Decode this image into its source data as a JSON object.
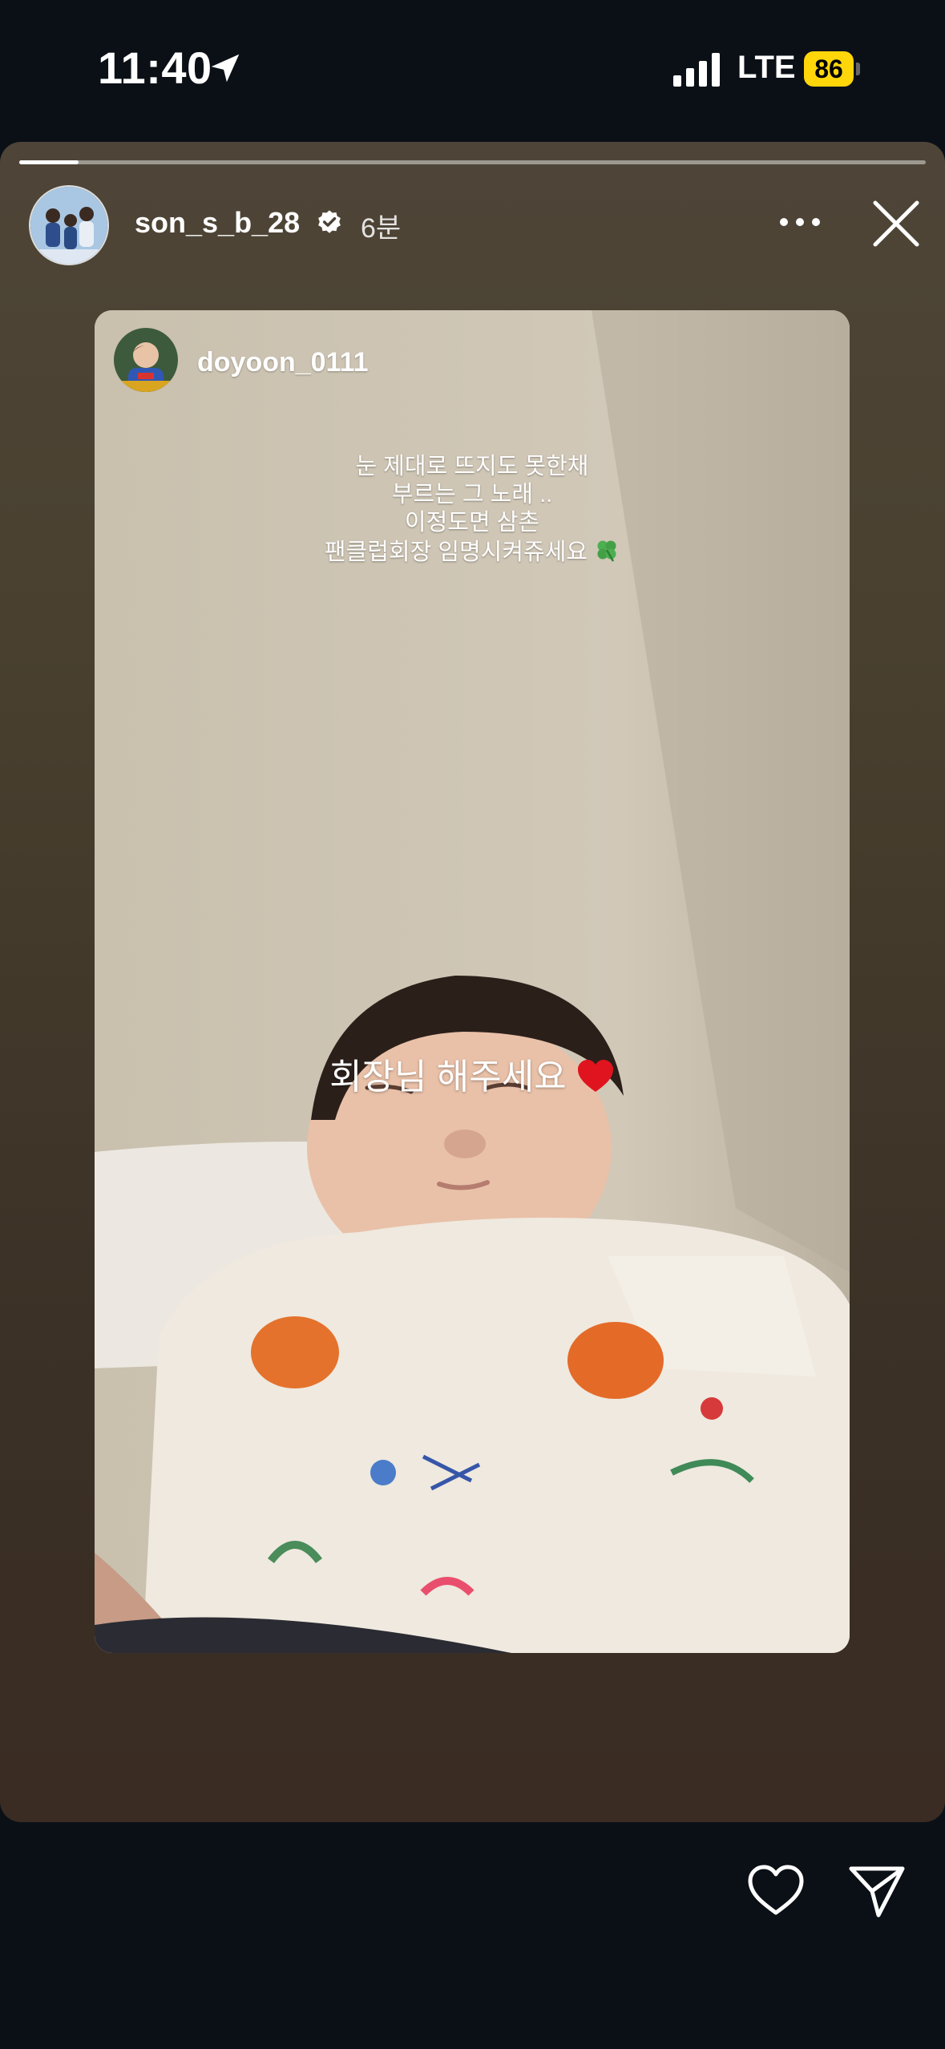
{
  "status_bar": {
    "time": "11:40",
    "network": "LTE",
    "battery": "86",
    "battery_color": "#ffd60a",
    "icons": [
      "location-arrow-icon",
      "signal-bars-icon",
      "battery-icon"
    ]
  },
  "story": {
    "progress_fraction": 0.065,
    "author": {
      "username": "son_s_b_28",
      "verified": true,
      "time_ago": "6분"
    },
    "header_icons": [
      "more-icon",
      "close-icon"
    ],
    "shared_post": {
      "username": "doyoon_0111",
      "caption_lines": [
        "눈 제대로 뜨지도 못한채",
        "부르는 그 노래 ..",
        "이정도면 삼촌",
        "팬클럽회장 임명시켜쥬세요"
      ],
      "caption_emoji": "clover-icon",
      "sticker_text": "회장님 해주세요",
      "sticker_emoji": "heart-icon"
    }
  },
  "footer_icons": [
    "like-heart-icon",
    "send-icon"
  ],
  "colors": {
    "background": "#0b1017",
    "story_bg": "#463c2f",
    "heart_red": "#e0141e"
  }
}
